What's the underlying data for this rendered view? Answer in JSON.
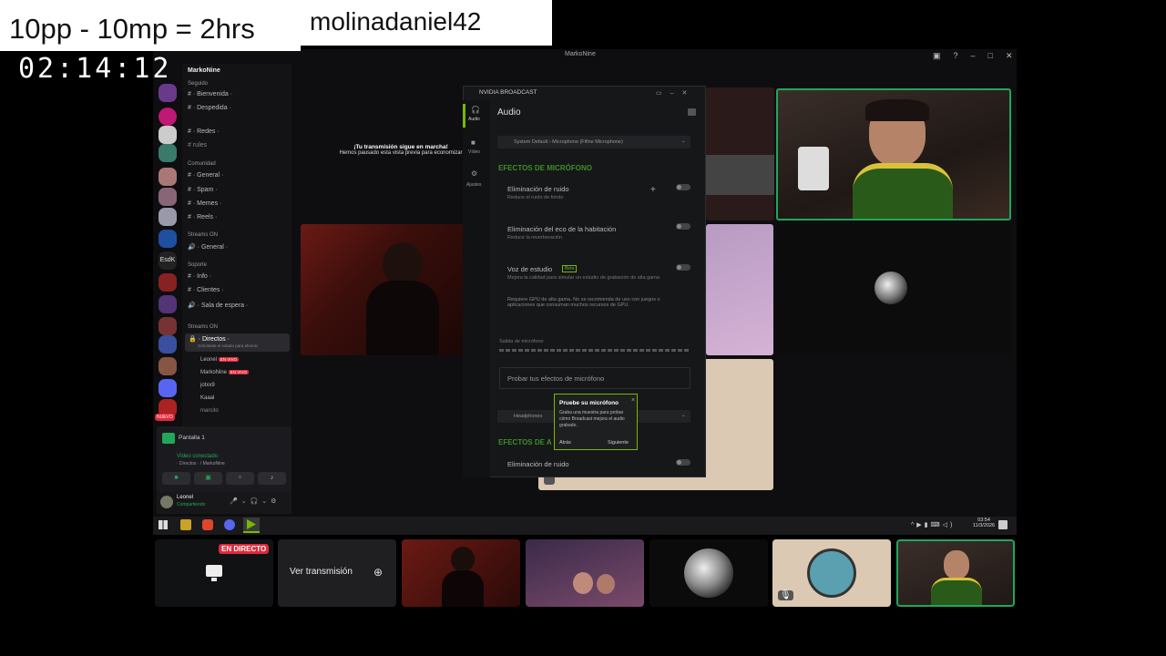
{
  "overlay": {
    "equation": "10pp - 10mp = 2hrs",
    "username": "molinadaniel42",
    "timer": "02:14:12"
  },
  "discord": {
    "window_title": "MarkoNine",
    "server_name": "MarkoNine",
    "categories": {
      "seguido": "Seguido",
      "comunidad": "Comunidad",
      "streams": "Streams ON",
      "soporte": "Soporte",
      "streams2": "Streams ON"
    },
    "channels": [
      {
        "label": "· Bienvenida ·",
        "icon": "#"
      },
      {
        "label": "· Despedida ·",
        "icon": "#"
      },
      {
        "label": "· Redes ·",
        "icon": "#"
      },
      {
        "label": "rules",
        "icon": "#"
      },
      {
        "label": "· General ·",
        "icon": "#"
      },
      {
        "label": "· Spam ·",
        "icon": "#"
      },
      {
        "label": "· Memes ·",
        "icon": "#"
      },
      {
        "label": "· Reels ·",
        "icon": "#"
      },
      {
        "label": "· General ·",
        "icon": "🔊"
      },
      {
        "label": "· Info ·",
        "icon": "#"
      },
      {
        "label": "· Clientes ·",
        "icon": "#"
      },
      {
        "label": "· Sala de espera ·",
        "icon": "🔊"
      },
      {
        "label": "· Directos ·",
        "icon": "🔒"
      }
    ],
    "directos_sub": "Solicitaste el estado para ahorrar",
    "voice_users": [
      {
        "name": "Leonel",
        "badge": "EN VIVO"
      },
      {
        "name": "MarkoNine",
        "badge": "EN VIVO"
      },
      {
        "name": "jotxx9",
        "badge": ""
      },
      {
        "name": "Kaaal",
        "badge": ""
      },
      {
        "name": "marcito",
        "badge": ""
      }
    ],
    "screen_share": "Pantalla 1",
    "voice_status": "Vídeo conectado",
    "voice_channel": "· Directos · / MarkoNine",
    "current_user": "Leonel",
    "current_user_status": "Compartiendo",
    "nuevo_badge": "NUEVO",
    "stage_title": "¡Tu transmisión sigue en marcha!",
    "stage_sub": "Hemos pausado esta vista previa para economizar"
  },
  "nvidia": {
    "title": "NVIDIA BROADCAST",
    "section": "Audio",
    "nav": [
      "Audio",
      "Vídeo",
      "Ajustes"
    ],
    "device": "System Default › Microphone (Fifine Microphone)",
    "mic_effects_header": "EFECTOS DE MICRÓFONO",
    "effects": [
      {
        "name": "Eliminación de ruido",
        "desc": "Reduce el ruido de fondo"
      },
      {
        "name": "Eliminación del eco de la habitación",
        "desc": "Reduce la reverberación"
      },
      {
        "name": "Voz de estudio",
        "desc": "Mejora la calidad para simular un estudio de grabación de alta gama"
      }
    ],
    "beta": "Beta",
    "warning": "Requiere GPU de alta gama. No se recomienda de uso con juegos o aplicaciones que consuman muchos recursos de GPU.",
    "output_label": "Salida de micrófono",
    "test_button": "Probar tus efectos de micrófono",
    "speaker_device": "Headphones",
    "speaker_effects_header": "EFECTOS DE A",
    "speaker_effect": "Eliminación de ruido"
  },
  "tooltip": {
    "title": "Pruebe su micrófono",
    "body": "Graba una muestra para probar cómo Broadcast mejora el audio grabado.",
    "back": "Atrás",
    "next": "Siguiente",
    "close": "×"
  },
  "taskbar": {
    "time": "03:54",
    "date": "11/3/2026"
  },
  "bottom": {
    "live_badge": "EN DIRECTO",
    "watch_label": "Ver transmisión"
  },
  "colors": {
    "accent": "#76b900",
    "live": "#e0283a",
    "discord_green": "#23a55a"
  }
}
